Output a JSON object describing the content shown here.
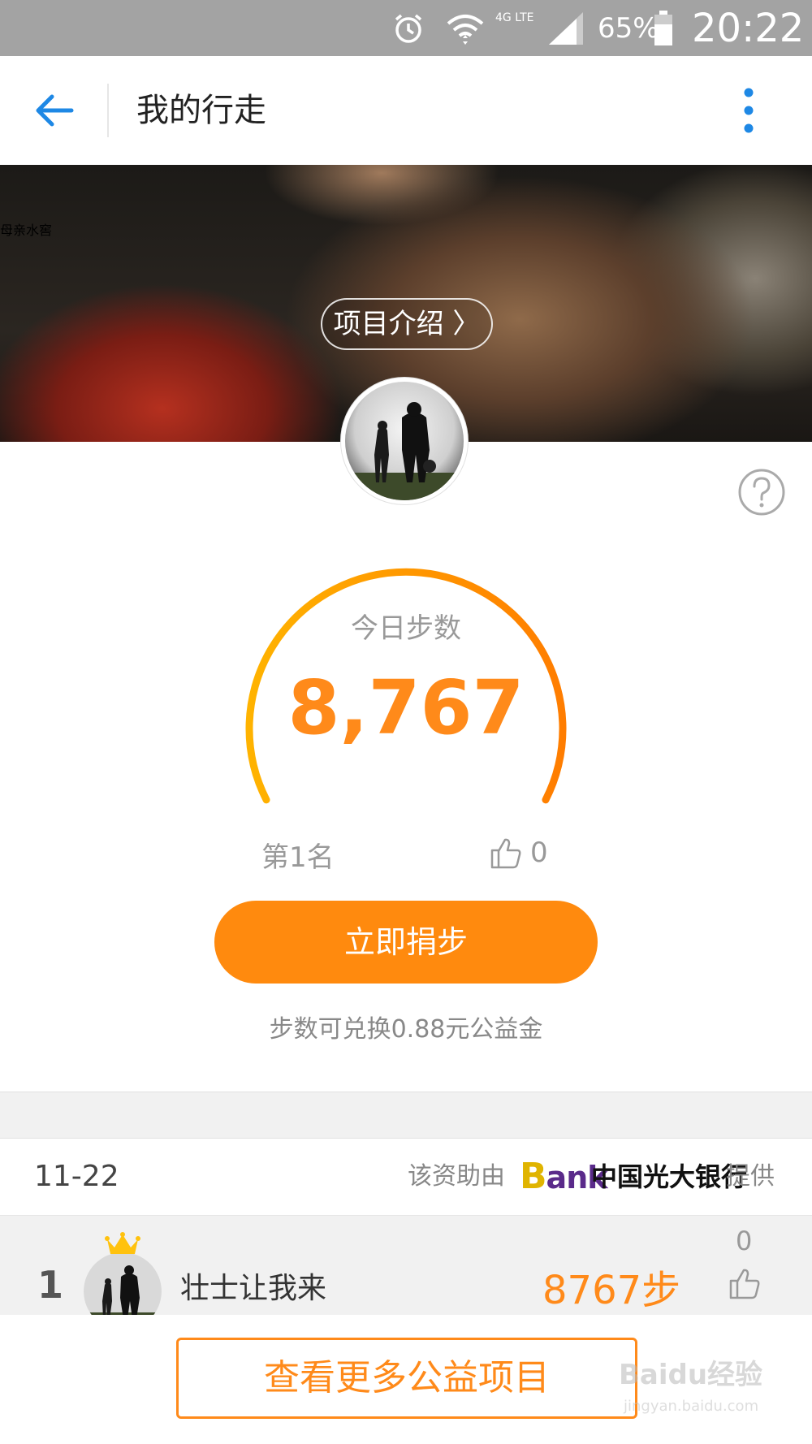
{
  "status_bar": {
    "network": "4G LTE",
    "battery": "65%",
    "time": "20:22"
  },
  "header": {
    "title": "我的行走"
  },
  "banner": {
    "title": "母亲水窖",
    "intro_button": "项目介绍 〉"
  },
  "steps": {
    "label": "今日步数",
    "value": "8,767",
    "rank": "第1名",
    "likes": "0",
    "progress": 1.0
  },
  "actions": {
    "donate_button": "立即捐步",
    "exchange_note": "步数可兑换0.88元公益金",
    "more_projects_button": "查看更多公益项目"
  },
  "sponsor": {
    "date": "11-22",
    "prefix": "该资助由",
    "logo_text": "Bank",
    "bank_name": "中国光大银行",
    "suffix": "提供"
  },
  "leaderboard": [
    {
      "rank": "1",
      "name": "壮士让我来",
      "steps": "8767步",
      "likes": "0"
    }
  ],
  "watermark": {
    "main": "Baidu经验",
    "sub": "jingyan.baidu.com"
  },
  "colors": {
    "accent": "#ff8a1a",
    "header_icon": "#1e88e5",
    "status_bar": "#a3a3a3"
  }
}
